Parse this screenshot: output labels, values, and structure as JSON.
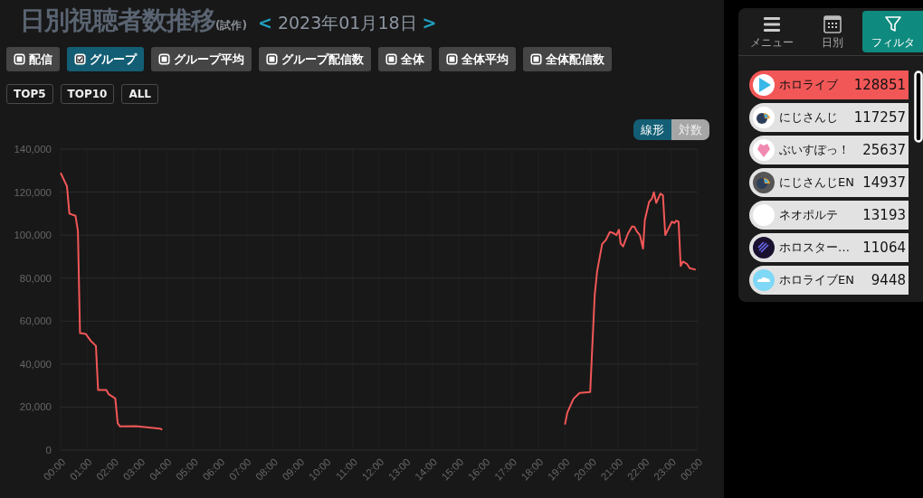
{
  "header": {
    "title": "日別視聴者数推移",
    "subtitle": "(試作)",
    "prev": "<",
    "date": "2023年01月18日",
    "next": ">"
  },
  "filters": [
    {
      "label": "配信",
      "checked": false
    },
    {
      "label": "グループ",
      "checked": true
    },
    {
      "label": "グループ平均",
      "checked": false
    },
    {
      "label": "グループ配信数",
      "checked": false
    },
    {
      "label": "全体",
      "checked": false
    },
    {
      "label": "全体平均",
      "checked": false
    },
    {
      "label": "全体配信数",
      "checked": false
    }
  ],
  "top_buttons": [
    "TOP5",
    "TOP10",
    "ALL"
  ],
  "scale_toggle": [
    {
      "label": "線形",
      "selected": true
    },
    {
      "label": "対数",
      "selected": false
    }
  ],
  "chart_data": {
    "type": "line",
    "x": [
      0,
      0.24,
      0.33,
      0.56,
      0.65,
      0.73,
      0.95,
      1.12,
      1.33,
      1.41,
      1.72,
      1.81,
      2.06,
      2.15,
      2.24,
      2.83,
      3.74,
      3.83,
      11,
      19.0,
      19.09,
      19.32,
      19.55,
      19.95,
      20.12,
      20.21,
      20.4,
      20.55,
      20.69,
      20.82,
      20.94,
      21.03,
      21.1,
      21.19,
      21.37,
      21.53,
      21.62,
      21.71,
      21.82,
      21.94,
      22.01,
      22.17,
      22.28,
      22.35,
      22.44,
      22.6,
      22.69,
      22.78,
      23.03,
      23.12,
      23.19,
      23.28,
      23.36,
      23.44,
      23.59,
      23.7,
      23.93
    ],
    "grid": true,
    "series": [
      {
        "color": "#f25757",
        "values": [
          129000,
          122700,
          110000,
          109000,
          102000,
          54500,
          54000,
          51000,
          48500,
          28000,
          28000,
          26000,
          24000,
          12500,
          11000,
          11200,
          10000,
          9500,
          null,
          11900,
          17500,
          23800,
          26600,
          27000,
          72000,
          83000,
          95800,
          97900,
          101400,
          101000,
          100000,
          102500,
          96000,
          94700,
          100700,
          104000,
          103800,
          101700,
          100000,
          93700,
          107000,
          115400,
          117000,
          119900,
          115000,
          119300,
          118500,
          100000,
          106300,
          105600,
          106700,
          106300,
          85700,
          87700,
          86700,
          84600,
          83900
        ]
      }
    ],
    "xlim": [
      0,
      24
    ],
    "ylim": [
      0,
      140000
    ],
    "xticks": [
      {
        "value": 0,
        "label": "00:00"
      },
      {
        "value": 1,
        "label": "01:00"
      },
      {
        "value": 2,
        "label": "02:00"
      },
      {
        "value": 3,
        "label": "03:00"
      },
      {
        "value": 4,
        "label": "04:00"
      },
      {
        "value": 5,
        "label": "05:00"
      },
      {
        "value": 6,
        "label": "06:00"
      },
      {
        "value": 7,
        "label": "07:00"
      },
      {
        "value": 8,
        "label": "08:00"
      },
      {
        "value": 9,
        "label": "09:00"
      },
      {
        "value": 10,
        "label": "10:00"
      },
      {
        "value": 11,
        "label": "11:00"
      },
      {
        "value": 12,
        "label": "12:00"
      },
      {
        "value": 13,
        "label": "13:00"
      },
      {
        "value": 14,
        "label": "14:00"
      },
      {
        "value": 15,
        "label": "15:00"
      },
      {
        "value": 16,
        "label": "16:00"
      },
      {
        "value": 17,
        "label": "17:00"
      },
      {
        "value": 18,
        "label": "18:00"
      },
      {
        "value": 19,
        "label": "19:00"
      },
      {
        "value": 20,
        "label": "20:00"
      },
      {
        "value": 21,
        "label": "21:00"
      },
      {
        "value": 22,
        "label": "22:00"
      },
      {
        "value": 23,
        "label": "23:00"
      },
      {
        "value": 24,
        "label": "00:00"
      }
    ],
    "yticks": [
      {
        "value": 0,
        "label": "0"
      },
      {
        "value": 20000,
        "label": "20,000"
      },
      {
        "value": 40000,
        "label": "40,000"
      },
      {
        "value": 60000,
        "label": "60,000"
      },
      {
        "value": 80000,
        "label": "80,000"
      },
      {
        "value": 100000,
        "label": "100,000"
      },
      {
        "value": 120000,
        "label": "120,000"
      },
      {
        "value": 140000,
        "label": "140,000"
      }
    ]
  },
  "nav_tabs": [
    {
      "label": "メニュー",
      "kind": "menu",
      "selected": false
    },
    {
      "label": "日別",
      "kind": "calendar",
      "selected": false
    },
    {
      "label": "フィルタ",
      "kind": "filter",
      "selected": true
    }
  ],
  "groups": [
    {
      "name": "ホロライブ",
      "count": "128851",
      "kind": "play",
      "selected": true
    },
    {
      "name": "にじさんじ",
      "count": "117257",
      "kind": "chat",
      "selected": false
    },
    {
      "name": "ぶいすぽっ！",
      "count": "25637",
      "kind": "heart",
      "selected": false
    },
    {
      "name": "にじさんじEN",
      "count": "14937",
      "kind": "chat-dark",
      "selected": false
    },
    {
      "name": "ネオポルテ",
      "count": "13193",
      "kind": "blank",
      "selected": false
    },
    {
      "name": "ホロスター…",
      "count": "11064",
      "kind": "stripes",
      "selected": false
    },
    {
      "name": "ホロライブEN",
      "count": "9448",
      "kind": "cloud",
      "selected": false
    }
  ]
}
